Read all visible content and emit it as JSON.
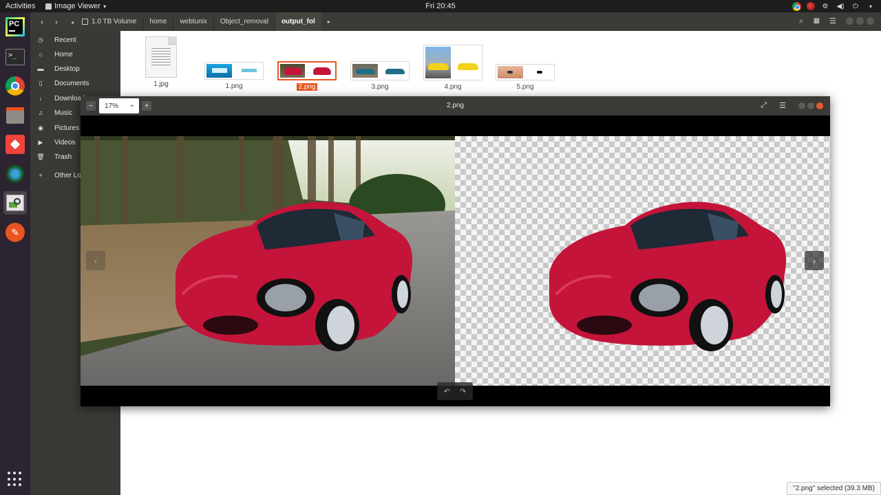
{
  "topbar": {
    "activities": "Activities",
    "app_name": "Image Viewer",
    "clock": "Fri 20:45"
  },
  "dock": {
    "items": [
      "pycharm-icon",
      "terminal-icon",
      "chrome-icon",
      "file-manager-icon",
      "anydesk-icon",
      "camera-icon",
      "image-viewer-icon",
      "inkscape-icon"
    ]
  },
  "files": {
    "breadcrumbs": [
      {
        "label": "1.0 TB Volume"
      },
      {
        "label": "home"
      },
      {
        "label": "webtunix"
      },
      {
        "label": "Object_removal"
      },
      {
        "label": "output_fol"
      }
    ],
    "sidebar": [
      {
        "label": "Recent",
        "icon": "clock-icon"
      },
      {
        "label": "Home",
        "icon": "home-icon"
      },
      {
        "label": "Desktop",
        "icon": "folder-icon"
      },
      {
        "label": "Documents",
        "icon": "document-icon"
      },
      {
        "label": "Downloads",
        "icon": "download-icon"
      },
      {
        "label": "Music",
        "icon": "music-icon"
      },
      {
        "label": "Pictures",
        "icon": "camera-icon"
      },
      {
        "label": "Videos",
        "icon": "video-icon"
      },
      {
        "label": "Trash",
        "icon": "trash-icon"
      },
      {
        "label": "Other Locations",
        "icon": "plus-icon"
      }
    ],
    "items": [
      {
        "name": "1.jpg"
      },
      {
        "name": "1.png"
      },
      {
        "name": "2.png",
        "selected": true
      },
      {
        "name": "3.png"
      },
      {
        "name": "4.png"
      },
      {
        "name": "5.png"
      }
    ],
    "status": "\"2.png\" selected  (39.3 MB)"
  },
  "viewer": {
    "title": "2.png",
    "zoom": "17%",
    "colors": {
      "accent": "#e95420",
      "car": "#c4143a"
    }
  }
}
